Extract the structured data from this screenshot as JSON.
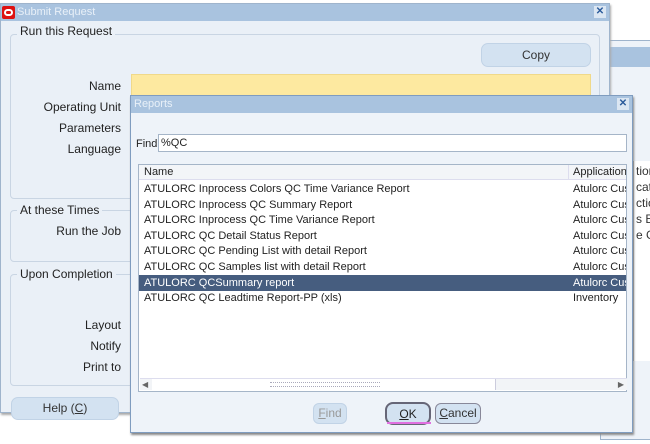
{
  "background_window": {
    "fragments": [
      "tion",
      "cat",
      "ctio",
      "s E",
      "e G"
    ]
  },
  "submit": {
    "title": "Submit Request",
    "run_group": "Run this Request",
    "copy": "Copy",
    "labels": {
      "name": "Name",
      "operating_unit": "Operating Unit",
      "parameters": "Parameters",
      "language": "Language"
    },
    "name_value": "",
    "times_group": "At these Times",
    "run_the_job": "Run the Job",
    "completion_group": "Upon Completion",
    "layout": "Layout",
    "notify": "Notify",
    "print_to": "Print to",
    "help": "Help (",
    "help_key": "C",
    "help_end": ")"
  },
  "reports": {
    "title": "Reports",
    "find_label": "Find",
    "find_value": "%QC",
    "columns": [
      "Name",
      "Application"
    ],
    "rows": [
      {
        "name": "ATULORC Inprocess Colors QC Time Variance Report",
        "app": "Atulorc Cus"
      },
      {
        "name": "ATULORC Inprocess QC Summary Report",
        "app": "Atulorc Cus"
      },
      {
        "name": "ATULORC Inprocess QC Time Variance Report",
        "app": "Atulorc Cus"
      },
      {
        "name": "ATULORC QC Detail Status Report",
        "app": "Atulorc Cus"
      },
      {
        "name": "ATULORC QC Pending List with detail Report",
        "app": "Atulorc Cus"
      },
      {
        "name": "ATULORC QC Samples list with detail Report",
        "app": "Atulorc Cus"
      },
      {
        "name": "ATULORC QCSummary report",
        "app": "Atulorc Cus",
        "selected": true
      },
      {
        "name": "ATULORC QC Leadtime Report-PP (xls)",
        "app": "Inventory"
      }
    ],
    "find_btn_key": "F",
    "find_btn_rest": "ind",
    "ok_key": "O",
    "ok_rest": "K",
    "cancel_key": "C",
    "cancel_rest": "ancel"
  },
  "colors": {
    "title_bar": "#a9c3df",
    "selected_row": "#465d7f",
    "required_field": "#fde9a0",
    "focus_underline": "#e070e0"
  }
}
